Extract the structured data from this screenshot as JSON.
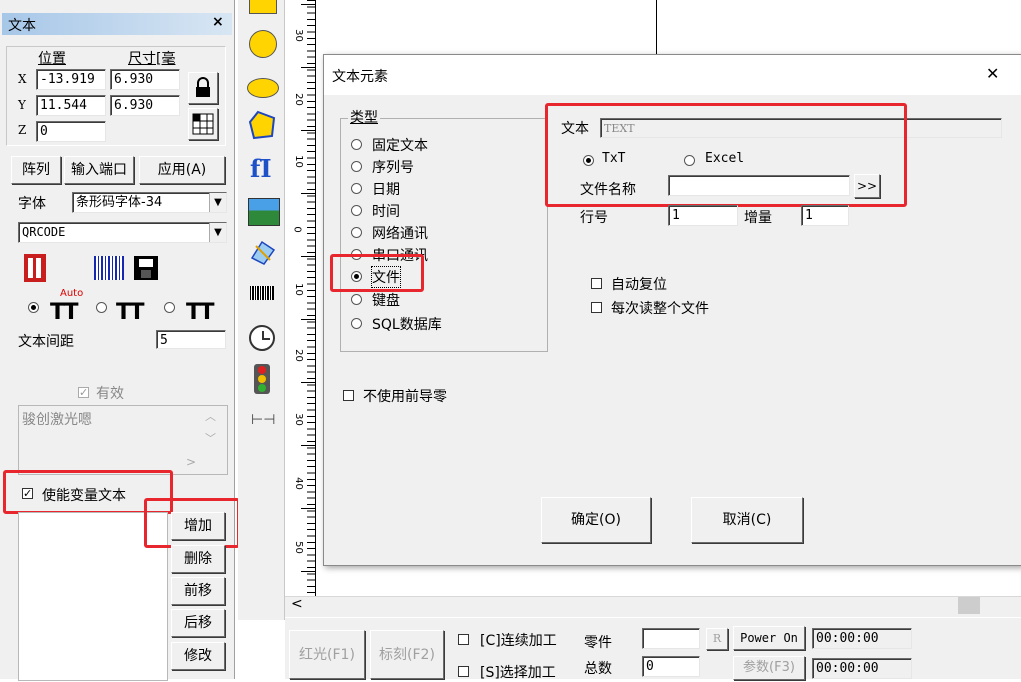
{
  "left_panel": {
    "title": "文本",
    "close": "×",
    "pos_label": "位置",
    "size_label": "尺寸[毫",
    "x_label": "X",
    "y_label": "Y",
    "z_label": "Z",
    "x_value": "-13.919",
    "y_value": "11.544",
    "z_value": "0",
    "w_value": "6.930",
    "h_value": "6.930",
    "btn_array": "阵列",
    "btn_input_port": "输入端口",
    "btn_apply": "应用(A)",
    "font_label": "字体",
    "font_value": "条形码字体-34",
    "code_value": "QRCODE",
    "auto_label": "Auto",
    "text_spacing_label": "文本间距",
    "text_spacing_value": "5",
    "valid_label": "有效",
    "textarea_value": "骏创激光嗯",
    "enable_var_text": "使能变量文本",
    "btn_add": "增加",
    "btn_delete": "删除",
    "btn_forward": "前移",
    "btn_back": "后移",
    "btn_modify": "修改"
  },
  "ruler": {
    "labels": [
      "30",
      "20",
      "10",
      "0",
      "10",
      "20",
      "30",
      "40",
      "50"
    ]
  },
  "bottom_bar": {
    "btn_red": "红光(F1)",
    "btn_mark": "标刻(F2)",
    "continuous": "[C]连续加工",
    "select": "[S]选择加工",
    "parts_label": "零件",
    "total_label": "总数",
    "total_value": "0",
    "r_label": "R",
    "power_on": "Power On",
    "params": "参数(F3)",
    "time1": "00:00:00",
    "time2": "00:00:00"
  },
  "dialog": {
    "title": "文本元素",
    "close": "✕",
    "type_group": "类型",
    "types": [
      "固定文本",
      "序列号",
      "日期",
      "时间",
      "网络通讯",
      "串口通讯",
      "文件",
      "键盘",
      "SQL数据库"
    ],
    "text_label": "文本",
    "text_value": "TEXT",
    "opt_txt": "TxT",
    "opt_excel": "Excel",
    "filename_label": "文件名称",
    "browse": ">>",
    "line_label": "行号",
    "line_value": "1",
    "incr_label": "增量",
    "incr_value": "1",
    "auto_reset": "自动复位",
    "read_whole": "每次读整个文件",
    "no_leading_zero": "不使用前导零",
    "ok": "确定(O)",
    "cancel": "取消(C)"
  }
}
